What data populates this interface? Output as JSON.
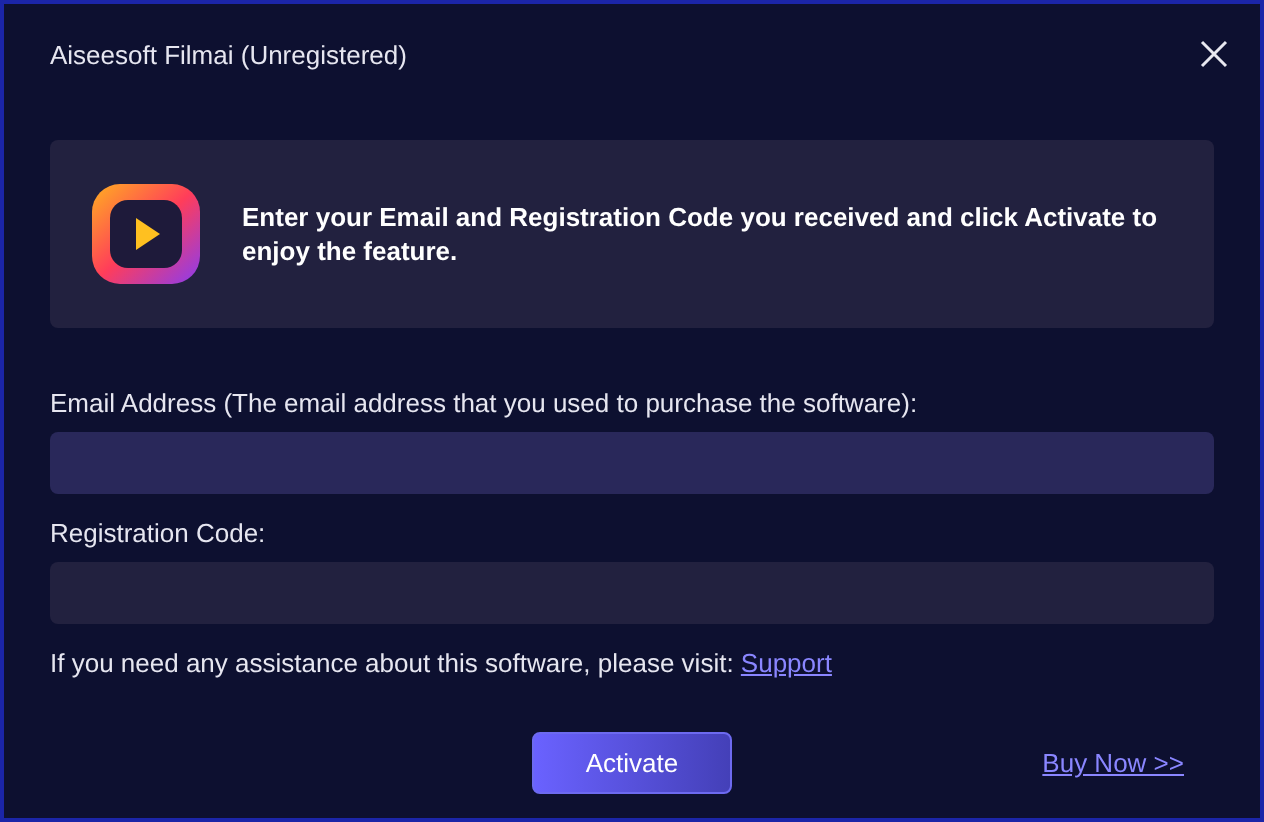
{
  "window": {
    "title": "Aiseesoft Filmai (Unregistered)"
  },
  "banner": {
    "message": "Enter your Email and Registration Code you received and click Activate to enjoy the feature."
  },
  "fields": [
    {
      "label": "Email Address (The email address that you used to purchase the software):",
      "kind": "email"
    },
    {
      "label": "Registration Code:",
      "kind": "code"
    }
  ],
  "help": {
    "text": "If you need any assistance about this software, please visit:",
    "link": "Support"
  },
  "buttons": {
    "activate": "Activate",
    "buy_now": "Buy Now >>"
  }
}
